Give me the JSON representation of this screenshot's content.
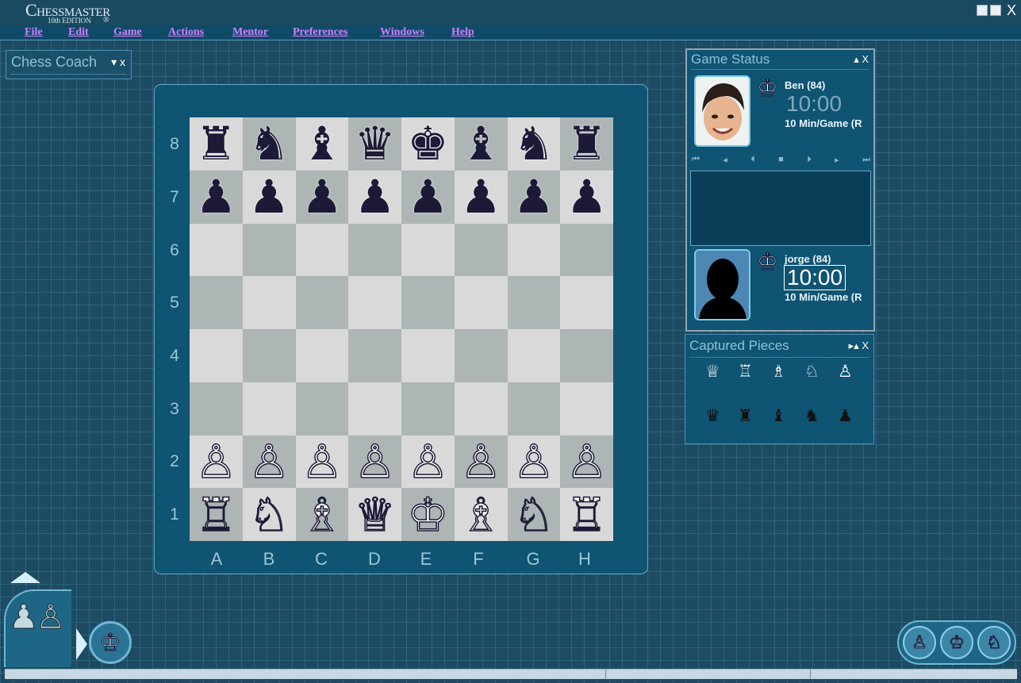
{
  "app": {
    "logo_main": "Chessmaster",
    "logo_sub": "10th EDITION",
    "logo_reg": "®",
    "close_glyph": "X"
  },
  "menu": [
    "File",
    "Edit",
    "Game",
    "Actions",
    "Mentor",
    "Preferences",
    "Windows",
    "Help"
  ],
  "chess_coach": {
    "title": "Chess Coach",
    "controls": "▾ x"
  },
  "board": {
    "ranks": [
      "8",
      "7",
      "6",
      "5",
      "4",
      "3",
      "2",
      "1"
    ],
    "files": [
      "A",
      "B",
      "C",
      "D",
      "E",
      "F",
      "G",
      "H"
    ],
    "rows": [
      [
        "r",
        "n",
        "b",
        "q",
        "k",
        "b",
        "n",
        "r"
      ],
      [
        "p",
        "p",
        "p",
        "p",
        "p",
        "p",
        "p",
        "p"
      ],
      [
        "",
        "",
        "",
        "",
        "",
        "",
        "",
        ""
      ],
      [
        "",
        "",
        "",
        "",
        "",
        "",
        "",
        ""
      ],
      [
        "",
        "",
        "",
        "",
        "",
        "",
        "",
        ""
      ],
      [
        "",
        "",
        "",
        "",
        "",
        "",
        "",
        ""
      ],
      [
        "P",
        "P",
        "P",
        "P",
        "P",
        "P",
        "P",
        "P"
      ],
      [
        "R",
        "N",
        "B",
        "Q",
        "K",
        "B",
        "N",
        "R"
      ]
    ]
  },
  "game_status": {
    "title": "Game Status",
    "controls": "▴ X",
    "top_player": {
      "name": "Ben (84)",
      "time": "10:00",
      "mode": "10 Min/Game (R"
    },
    "bottom_player": {
      "name": "jorge (84)",
      "time": "10:00",
      "mode": "10 Min/Game (R"
    },
    "nav_buttons": [
      "⏮",
      "◂",
      "⏴",
      "■",
      "⏵",
      "▸",
      "⏭"
    ]
  },
  "captured_pieces": {
    "title": "Captured Pieces",
    "controls": "▸▴ X",
    "white_row": [
      "♕",
      "♖",
      "♗",
      "♘",
      "♙"
    ],
    "black_row": [
      "♛",
      "♜",
      "♝",
      "♞",
      "♟"
    ]
  },
  "colors": {
    "background": "#1d4b62",
    "panel": "#0f5472",
    "menu_text": "#cf7fff",
    "light_square": "#d9d9d9",
    "dark_square": "#aeb5b5"
  }
}
